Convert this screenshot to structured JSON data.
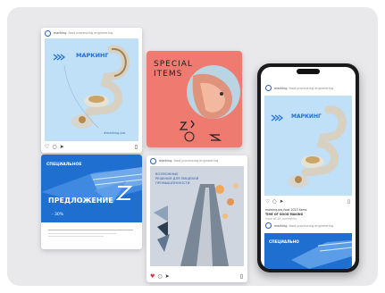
{
  "brand": {
    "handle": "marking",
    "tagline": "food processing engineering"
  },
  "colors": {
    "blue": "#1f6fd1",
    "lightblue": "#bfe0f7",
    "coral": "#ef7a70",
    "dark": "#1a1a1d"
  },
  "posts": [
    {
      "id": "marking",
      "title": "МАРКИНГ",
      "caption": "#marking.pro"
    },
    {
      "id": "special",
      "title_line1": "SPECIAL",
      "title_line2": "ITEMS"
    },
    {
      "id": "offer",
      "label": "СПЕЦИАЛЬНОЕ",
      "headline": "ПРЕДЛОЖЕНИЕ",
      "discount": "- 30%"
    },
    {
      "id": "conveyor",
      "text_line1": "ВОЗМОЖНЫЕ",
      "text_line2": "РЕШЕНИЯ ДЛЯ ПИЩЕВОЙ",
      "text_line3": "ПРОМЫШЛЕННОСТИ"
    }
  ],
  "icons": {
    "like": "heart-icon",
    "comment": "comment-icon",
    "share": "send-icon",
    "save": "bookmark-icon"
  },
  "phone": {
    "post_title": "МАРКИНГ",
    "caption_line1": "marking.pro food 2023 items",
    "caption_line2": "TIME OF GOOD MAKING",
    "caption_line3": "View all 24 comments",
    "next_label": "СПЕЦИАЛЬНО"
  }
}
